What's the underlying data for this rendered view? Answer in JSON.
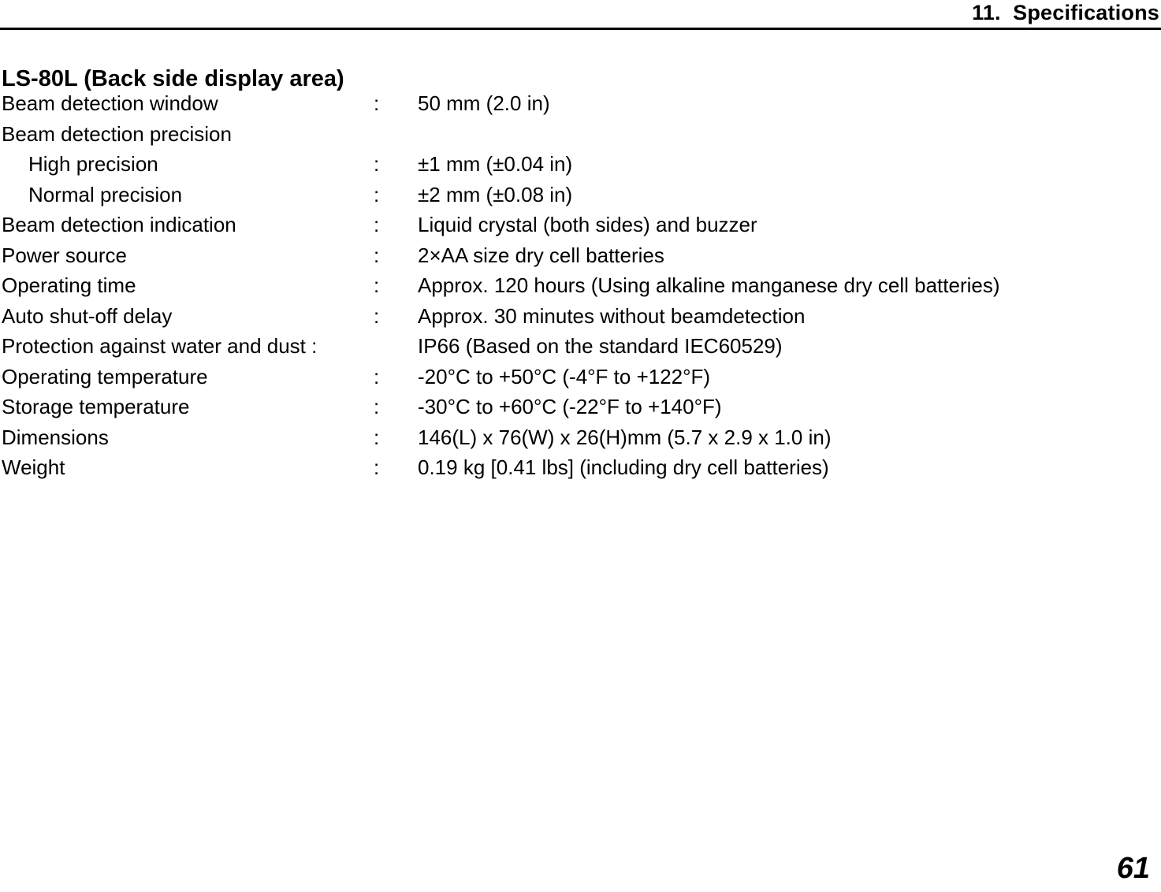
{
  "header": {
    "title": "11.  Specifications"
  },
  "section": {
    "title": "LS-80L (Back side display area)"
  },
  "colon": ":",
  "specs": [
    {
      "label": "Beam detection window",
      "value": "50 mm (2.0 in)",
      "indent": false,
      "has_value": true,
      "colon_inline": false
    },
    {
      "label": "Beam detection precision",
      "value": "",
      "indent": false,
      "has_value": false,
      "colon_inline": false
    },
    {
      "label": "High precision",
      "value": "±1 mm (±0.04 in)",
      "indent": true,
      "has_value": true,
      "colon_inline": false
    },
    {
      "label": "Normal precision",
      "value": "±2 mm (±0.08 in)",
      "indent": true,
      "has_value": true,
      "colon_inline": false
    },
    {
      "label": "Beam detection indication",
      "value": "Liquid crystal (both sides) and buzzer",
      "indent": false,
      "has_value": true,
      "colon_inline": false
    },
    {
      "label": "Power source",
      "value": "2×AA size dry cell batteries",
      "indent": false,
      "has_value": true,
      "colon_inline": false
    },
    {
      "label": "Operating time",
      "value": "Approx. 120 hours (Using alkaline manganese dry cell batteries)",
      "indent": false,
      "has_value": true,
      "colon_inline": false
    },
    {
      "label": "Auto shut-off delay",
      "value": "Approx. 30 minutes without beamdetection",
      "indent": false,
      "has_value": true,
      "colon_inline": false
    },
    {
      "label": "Protection against water and dust :",
      "value": "IP66 (Based on the standard IEC60529)",
      "indent": false,
      "has_value": true,
      "colon_inline": true
    },
    {
      "label": "Operating temperature",
      "value": "-20°C to +50°C (-4°F to +122°F)",
      "indent": false,
      "has_value": true,
      "colon_inline": false
    },
    {
      "label": "Storage temperature",
      "value": "-30°C to +60°C (-22°F to +140°F)",
      "indent": false,
      "has_value": true,
      "colon_inline": false
    },
    {
      "label": "Dimensions",
      "value": "146(L) x 76(W) x 26(H)mm (5.7 x 2.9 x 1.0 in)",
      "indent": false,
      "has_value": true,
      "colon_inline": false
    },
    {
      "label": "Weight",
      "value": "0.19 kg [0.41 lbs] (including dry cell batteries)",
      "indent": false,
      "has_value": true,
      "colon_inline": false
    }
  ],
  "footer": {
    "page_number": "61"
  }
}
